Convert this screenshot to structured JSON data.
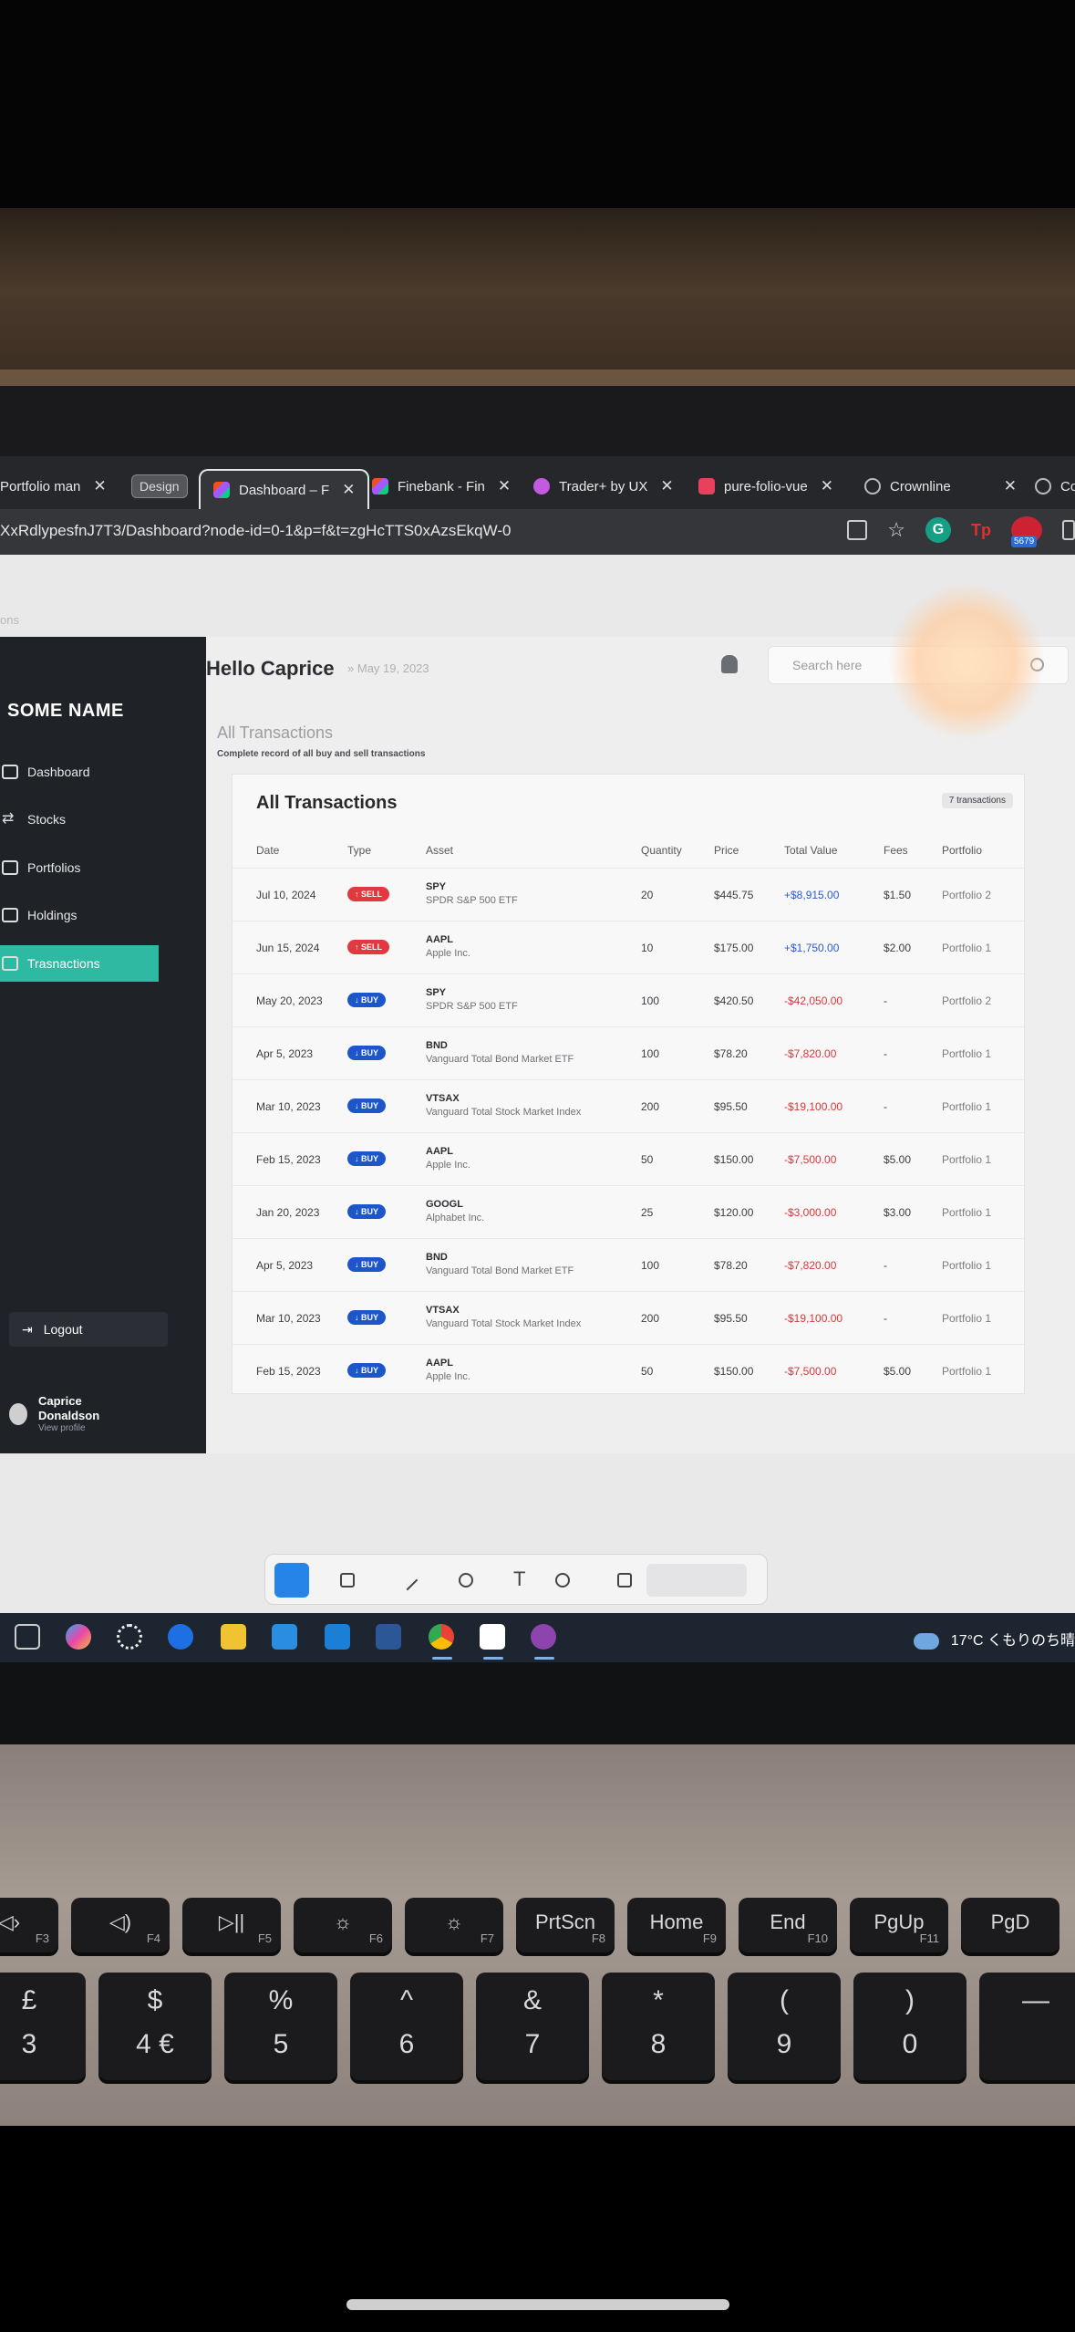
{
  "browser": {
    "tabs": [
      {
        "label": "Portfolio man"
      },
      {
        "label": "Design"
      },
      {
        "label": "Dashboard – F"
      },
      {
        "label": "Finebank - Fin"
      },
      {
        "label": "Trader+ by UX"
      },
      {
        "label": "pure-folio-vue"
      },
      {
        "label": "Crownline"
      },
      {
        "label": "Co"
      }
    ],
    "url": "XxRdlypesfnJ7T3/Dashboard?node-id=0-1&p=f&t=zgHcTTS0xAzsEkqW-0",
    "extension_badge": "5679",
    "extension_tp": "Tp",
    "extension_g": "G"
  },
  "app": {
    "brand": "SOME NAME",
    "nav": [
      {
        "label": "Dashboard",
        "icon": "dashboard-icon"
      },
      {
        "label": "Stocks",
        "icon": "arrows-icon"
      },
      {
        "label": "Portfolios",
        "icon": "portfolio-icon"
      },
      {
        "label": "Holdings",
        "icon": "holdings-icon"
      },
      {
        "label": "Trasnactions",
        "icon": "grid-icon"
      }
    ],
    "logout": "Logout",
    "profile": {
      "name_line1": "Caprice",
      "name_line2": "Donaldson",
      "sub": "View profile"
    },
    "greeting": "Hello Caprice",
    "date": "May 19, 2023",
    "search_placeholder": "Search here",
    "section_title": "All Transactions",
    "section_subtitle": "Complete record of all buy and sell transactions",
    "card_title": "All Transactions",
    "count_badge": "7 transactions",
    "columns": [
      "Date",
      "Type",
      "Asset",
      "Quantity",
      "Price",
      "Total Value",
      "Fees",
      "Portfolio"
    ],
    "rows": [
      {
        "date": "Jul 10, 2024",
        "type": "↑ SELL",
        "kind": "sell",
        "symbol": "SPY",
        "name": "SPDR S&P 500 ETF",
        "qty": "20",
        "price": "$445.75",
        "total": "+$8,915.00",
        "fees": "$1.50",
        "portfolio": "Portfolio 2"
      },
      {
        "date": "Jun 15, 2024",
        "type": "↑ SELL",
        "kind": "sell",
        "symbol": "AAPL",
        "name": "Apple Inc.",
        "qty": "10",
        "price": "$175.00",
        "total": "+$1,750.00",
        "fees": "$2.00",
        "portfolio": "Portfolio 1"
      },
      {
        "date": "May 20, 2023",
        "type": "↓ BUY",
        "kind": "buy",
        "symbol": "SPY",
        "name": "SPDR S&P 500 ETF",
        "qty": "100",
        "price": "$420.50",
        "total": "-$42,050.00",
        "fees": "-",
        "portfolio": "Portfolio 2"
      },
      {
        "date": "Apr 5, 2023",
        "type": "↓ BUY",
        "kind": "buy",
        "symbol": "BND",
        "name": "Vanguard Total Bond Market ETF",
        "qty": "100",
        "price": "$78.20",
        "total": "-$7,820.00",
        "fees": "-",
        "portfolio": "Portfolio 1"
      },
      {
        "date": "Mar 10, 2023",
        "type": "↓ BUY",
        "kind": "buy",
        "symbol": "VTSAX",
        "name": "Vanguard Total Stock Market Index",
        "qty": "200",
        "price": "$95.50",
        "total": "-$19,100.00",
        "fees": "-",
        "portfolio": "Portfolio 1"
      },
      {
        "date": "Feb 15, 2023",
        "type": "↓ BUY",
        "kind": "buy",
        "symbol": "AAPL",
        "name": "Apple Inc.",
        "qty": "50",
        "price": "$150.00",
        "total": "-$7,500.00",
        "fees": "$5.00",
        "portfolio": "Portfolio 1"
      },
      {
        "date": "Jan 20, 2023",
        "type": "↓ BUY",
        "kind": "buy",
        "symbol": "GOOGL",
        "name": "Alphabet Inc.",
        "qty": "25",
        "price": "$120.00",
        "total": "-$3,000.00",
        "fees": "$3.00",
        "portfolio": "Portfolio 1"
      },
      {
        "date": "Apr 5, 2023",
        "type": "↓ BUY",
        "kind": "buy",
        "symbol": "BND",
        "name": "Vanguard Total Bond Market ETF",
        "qty": "100",
        "price": "$78.20",
        "total": "-$7,820.00",
        "fees": "-",
        "portfolio": "Portfolio 1"
      },
      {
        "date": "Mar 10, 2023",
        "type": "↓ BUY",
        "kind": "buy",
        "symbol": "VTSAX",
        "name": "Vanguard Total Stock Market Index",
        "qty": "200",
        "price": "$95.50",
        "total": "-$19,100.00",
        "fees": "-",
        "portfolio": "Portfolio 1"
      },
      {
        "date": "Feb 15, 2023",
        "type": "↓ BUY",
        "kind": "buy",
        "symbol": "AAPL",
        "name": "Apple Inc.",
        "qty": "50",
        "price": "$150.00",
        "total": "-$7,500.00",
        "fees": "$5.00",
        "portfolio": "Portfolio 1"
      }
    ]
  },
  "taskbar": {
    "weather": "17°C くもりのち晴"
  },
  "keyboard": {
    "fn_row": [
      {
        "main": "◁›",
        "sub": "F3"
      },
      {
        "main": "◁)",
        "sub": "F4"
      },
      {
        "main": "▷||",
        "sub": "F5"
      },
      {
        "main": "☼",
        "sub": "F6"
      },
      {
        "main": "☼",
        "sub": "F7"
      },
      {
        "main": "PrtScn",
        "sub": "F8"
      },
      {
        "main": "Home",
        "sub": "F9"
      },
      {
        "main": "End",
        "sub": "F10"
      },
      {
        "main": "PgUp",
        "sub": "F11"
      },
      {
        "main": "PgD",
        "sub": ""
      }
    ],
    "num_row": [
      {
        "top": "£",
        "bottom": "3"
      },
      {
        "top": "$",
        "bottom": "4 €"
      },
      {
        "top": "%",
        "bottom": "5"
      },
      {
        "top": "^",
        "bottom": "6"
      },
      {
        "top": "&",
        "bottom": "7"
      },
      {
        "top": "*",
        "bottom": "8"
      },
      {
        "top": "(",
        "bottom": "9"
      },
      {
        "top": ")",
        "bottom": "0"
      },
      {
        "top": "—",
        "bottom": ""
      }
    ]
  },
  "colors": {
    "accent": "#2eb9a2",
    "sell": "#e2383f",
    "buy": "#1d56c9",
    "sidebar": "#1f2227"
  }
}
